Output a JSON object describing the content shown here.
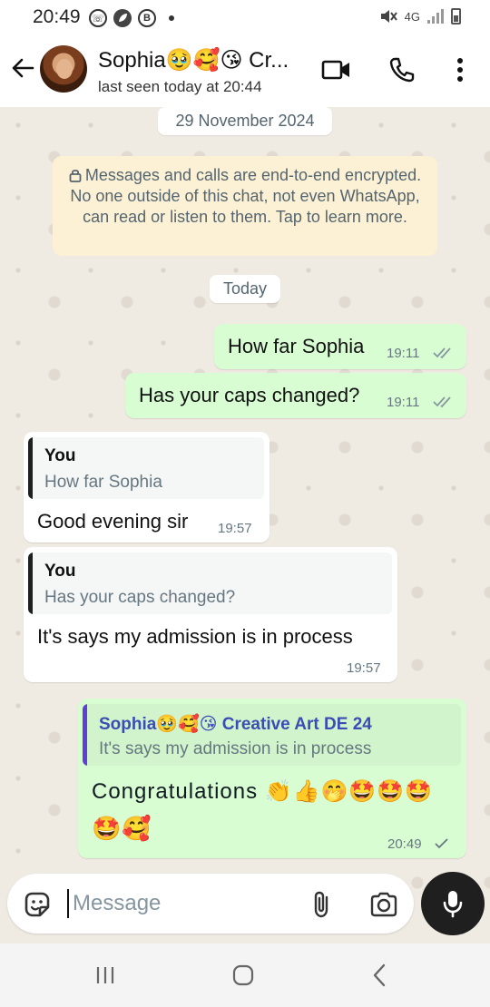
{
  "status_bar": {
    "time": "20:49",
    "network": "4G"
  },
  "header": {
    "contact_name": "Sophia🥹🥰😘 Cr...",
    "last_seen": "last seen today at 20:44",
    "icons": [
      "back-arrow-icon",
      "video-call-icon",
      "voice-call-icon",
      "more-vert-icon"
    ]
  },
  "chat": {
    "date_divider": "29 November 2024",
    "encryption_notice": "Messages and calls are end-to-end encrypted. No one outside of this chat, not even WhatsApp, can read or listen to them. Tap to learn more.",
    "today_divider": "Today",
    "messages": [
      {
        "direction": "out",
        "text": "How far Sophia",
        "time": "19:11",
        "status": "read"
      },
      {
        "direction": "out",
        "text": "Has your caps changed?",
        "time": "19:11",
        "status": "read"
      },
      {
        "direction": "in",
        "quote_author": "You",
        "quote_text": "How far Sophia",
        "text": "Good evening sir",
        "time": "19:57"
      },
      {
        "direction": "in",
        "quote_author": "You",
        "quote_text": "Has your caps changed?",
        "text": "It's says my admission is in process",
        "time": "19:57"
      },
      {
        "direction": "out",
        "quote_author": "Sophia🥹🥰😘 Creative Art DE 24",
        "quote_text": "It's says my admission is in process",
        "text": "Congratulations 👏👍🤭🤩🤩🤩",
        "text_line2": "🤩🥰",
        "time": "20:49",
        "status": "sent"
      }
    ]
  },
  "composer": {
    "placeholder": "Message"
  },
  "colors": {
    "outgoing_bubble": "#d9fdd3",
    "incoming_bubble": "#ffffff",
    "chat_background": "#efeae2",
    "read_ticks": "#8696a0",
    "quote_bar_in": "#1f1f1f",
    "quote_bar_out": "#5f3fd4",
    "quote_author_out": "#3a4db5"
  }
}
